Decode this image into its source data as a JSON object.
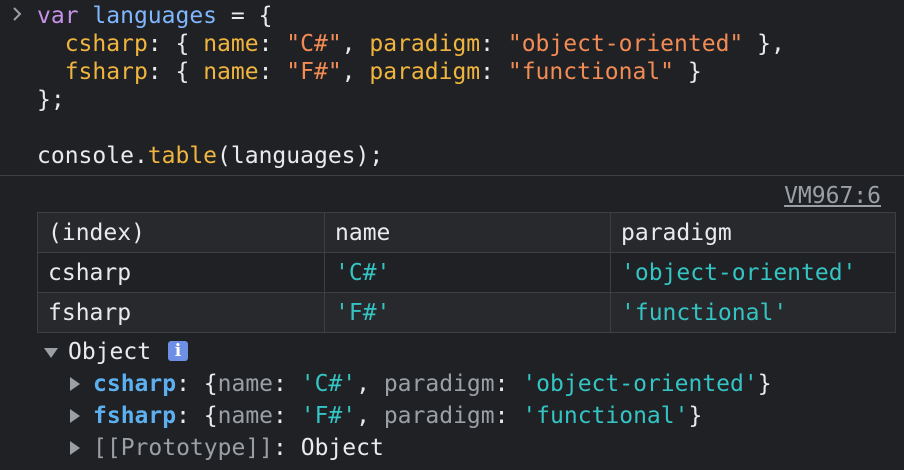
{
  "code": {
    "line1": {
      "keyword": "var",
      "name": "languages",
      "rest": " = {"
    },
    "line2": {
      "key": "csharp",
      "sep1": ": { ",
      "prop1": "name",
      "colon1": ": ",
      "val1": "\"C#\"",
      "comma": ", ",
      "prop2": "paradigm",
      "colon2": ": ",
      "val2": "\"object-oriented\"",
      "end": " },"
    },
    "line3": {
      "key": "fsharp",
      "sep1": ": { ",
      "prop1": "name",
      "colon1": ": ",
      "val1": "\"F#\"",
      "comma": ", ",
      "prop2": "paradigm",
      "colon2": ": ",
      "val2": "\"functional\"",
      "end": " }"
    },
    "line4": "};",
    "line6": {
      "obj": "console",
      "dot": ".",
      "method": "table",
      "args": "(languages);"
    }
  },
  "source_link": "VM967:6",
  "table": {
    "headers": [
      "(index)",
      "name",
      "paradigm"
    ],
    "rows": [
      {
        "index": "csharp",
        "name": "'C#'",
        "paradigm": "'object-oriented'"
      },
      {
        "index": "fsharp",
        "name": "'F#'",
        "paradigm": "'functional'"
      }
    ]
  },
  "tree": {
    "root_label": "Object",
    "info_glyph": "i",
    "items": [
      {
        "key": "csharp",
        "open": ": {",
        "p1": "name",
        "c1": ": ",
        "v1": "'C#'",
        "comma": ", ",
        "p2": "paradigm",
        "c2": ": ",
        "v2": "'object-oriented'",
        "close": "}"
      },
      {
        "key": "fsharp",
        "open": ": {",
        "p1": "name",
        "c1": ": ",
        "v1": "'F#'",
        "comma": ", ",
        "p2": "paradigm",
        "c2": ": ",
        "v2": "'functional'",
        "close": "}"
      }
    ],
    "prototype_key": "[[Prototype]]",
    "prototype_sep": ": ",
    "prototype_value": "Object"
  },
  "colors": {
    "background": "#202124",
    "keyword": "#c792ea",
    "variable": "#7fb7ff",
    "property": "#f0b53f",
    "string": "#f28b54",
    "console_string": "#34c4c4",
    "object_key": "#5db0f0",
    "info_badge": "#6e8fe6"
  },
  "icons": [
    "chevron-right-icon",
    "triangle-down-icon",
    "triangle-right-icon",
    "info-icon"
  ]
}
